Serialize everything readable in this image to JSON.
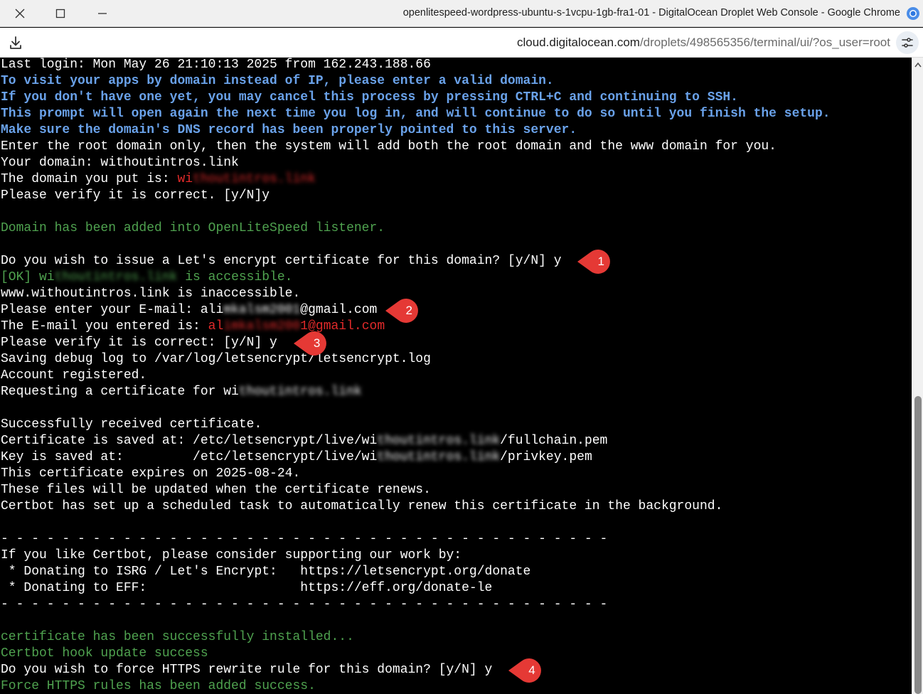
{
  "window": {
    "title": "openlitespeed-wordpress-ubuntu-s-1vcpu-1gb-fra1-01 - DigitalOcean Droplet Web Console - Google Chrome"
  },
  "address_bar": {
    "url_host": "cloud.digitalocean.com",
    "url_path": "/droplets/498565356/terminal/ui/?os_user=root"
  },
  "icons": {
    "close": "close-icon",
    "maximize": "maximize-icon",
    "minimize": "minimize-icon",
    "download": "download-icon",
    "site_settings": "tune-icon",
    "browser": "chrome-icon"
  },
  "colors": {
    "terminal_bg": "#000000",
    "text_white": "#ffffff",
    "text_blue": "#6aa2ea",
    "text_green": "#4fa24f",
    "text_red": "#e22a2a",
    "marker_red": "#e53935"
  },
  "terminal": {
    "lines": [
      [
        {
          "t": "Last login: Mon May 26 21:10:13 2025 from 162.243.188.66",
          "c": "white"
        }
      ],
      [
        {
          "t": "To visit your apps by domain instead of IP, please enter a valid domain.",
          "c": "blue"
        }
      ],
      [
        {
          "t": "If you don't have one yet, you may cancel this process by pressing CTRL+C and continuing to SSH.",
          "c": "blue"
        }
      ],
      [
        {
          "t": "This prompt will open again the next time you log in, and will continue to do so until you finish the setup.",
          "c": "blue"
        }
      ],
      [
        {
          "t": "Make sure the domain's DNS record has been properly pointed to this server.",
          "c": "blue"
        }
      ],
      [
        {
          "t": "Enter the root domain only, then the system will add both the root domain and the www domain for you.",
          "c": "white"
        }
      ],
      [
        {
          "t": "Your domain: withoutintros.link",
          "c": "white"
        }
      ],
      [
        {
          "t": "The domain you put is: ",
          "c": "white"
        },
        {
          "t": "wi",
          "c": "red"
        },
        {
          "t": "thoutintros.link",
          "c": "red",
          "blur": true
        }
      ],
      [
        {
          "t": "Please verify it is correct. [y/N]y",
          "c": "white"
        }
      ],
      [],
      [
        {
          "t": "Domain has been added into OpenLiteSpeed listener.",
          "c": "green"
        }
      ],
      [],
      [
        {
          "t": "Do you wish to issue a Let's encrypt certificate for this domain? [y/N] y",
          "c": "white"
        }
      ],
      [
        {
          "t": "[OK] wi",
          "c": "green"
        },
        {
          "t": "thoutintros.link",
          "c": "green",
          "blur": true
        },
        {
          "t": " is accessible.",
          "c": "green"
        }
      ],
      [
        {
          "t": "www.withoutintros.link is inaccessible.",
          "c": "white"
        }
      ],
      [
        {
          "t": "Please enter your E-mail: ali",
          "c": "white"
        },
        {
          "t": "mkalsm2001",
          "c": "white",
          "blur": true
        },
        {
          "t": "@gmail.com",
          "c": "white"
        }
      ],
      [
        {
          "t": "The E-mail you entered is: ",
          "c": "white"
        },
        {
          "t": "al",
          "c": "red"
        },
        {
          "t": "imkalsm200",
          "c": "red",
          "blur": true
        },
        {
          "t": "1@gmail.com",
          "c": "red"
        }
      ],
      [
        {
          "t": "Please verify it is correct: [y/N] y",
          "c": "white"
        }
      ],
      [
        {
          "t": "Saving debug log to /var/log/letsencrypt/letsencrypt.log",
          "c": "white"
        }
      ],
      [
        {
          "t": "Account registered.",
          "c": "white"
        }
      ],
      [
        {
          "t": "Requesting a certificate for wi",
          "c": "white"
        },
        {
          "t": "thoutintros.link",
          "c": "white",
          "blur": true
        }
      ],
      [],
      [
        {
          "t": "Successfully received certificate.",
          "c": "white"
        }
      ],
      [
        {
          "t": "Certificate is saved at: /etc/letsencrypt/live/wi",
          "c": "white"
        },
        {
          "t": "thoutintros.link",
          "c": "white",
          "blur": true
        },
        {
          "t": "/fullchain.pem",
          "c": "white"
        }
      ],
      [
        {
          "t": "Key is saved at:         /etc/letsencrypt/live/wi",
          "c": "white"
        },
        {
          "t": "thoutintros.link",
          "c": "white",
          "blur": true
        },
        {
          "t": "/privkey.pem",
          "c": "white"
        }
      ],
      [
        {
          "t": "This certificate expires on 2025-08-24.",
          "c": "white"
        }
      ],
      [
        {
          "t": "These files will be updated when the certificate renews.",
          "c": "white"
        }
      ],
      [
        {
          "t": "Certbot has set up a scheduled task to automatically renew this certificate in the background.",
          "c": "white"
        }
      ],
      [],
      [
        {
          "t": "- - - - - - - - - - - - - - - - - - - - - - - - - - - - - - - - - - - - - - - -",
          "c": "white"
        }
      ],
      [
        {
          "t": "If you like Certbot, please consider supporting our work by:",
          "c": "white"
        }
      ],
      [
        {
          "t": " * Donating to ISRG / Let's Encrypt:   https://letsencrypt.org/donate",
          "c": "white"
        }
      ],
      [
        {
          "t": " * Donating to EFF:                    https://eff.org/donate-le",
          "c": "white"
        }
      ],
      [
        {
          "t": "- - - - - - - - - - - - - - - - - - - - - - - - - - - - - - - - - - - - - - - -",
          "c": "white"
        }
      ],
      [],
      [
        {
          "t": "certificate has been successfully installed...",
          "c": "green"
        }
      ],
      [
        {
          "t": "Certbot hook update success",
          "c": "green"
        }
      ],
      [
        {
          "t": "Do you wish to force HTTPS rewrite rule for this domain? [y/N] y",
          "c": "white"
        }
      ],
      [
        {
          "t": "Force HTTPS rules has been added success.",
          "c": "green"
        }
      ]
    ]
  },
  "markers": [
    {
      "label": "1",
      "line": 12,
      "col": 74
    },
    {
      "label": "2",
      "line": 15,
      "col": 49
    },
    {
      "label": "3",
      "line": 17,
      "col": 37
    },
    {
      "label": "4",
      "line": 37,
      "col": 65
    }
  ]
}
